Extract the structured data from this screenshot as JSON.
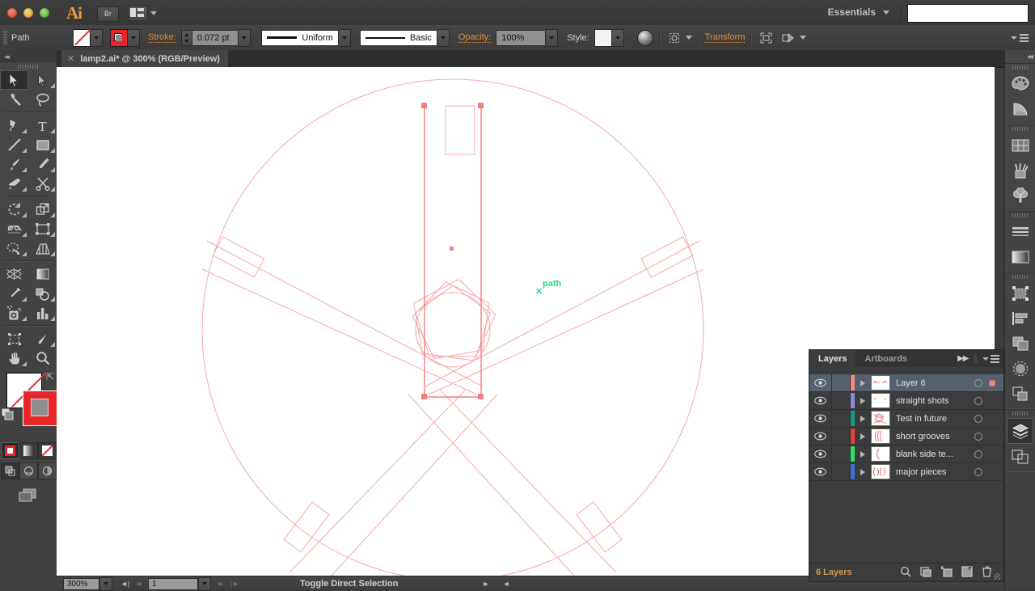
{
  "app": {
    "name": "Adobe Illustrator",
    "logo_text": "Ai",
    "bridge_label": "Br",
    "workspace": "Essentials",
    "search_value": ""
  },
  "control_bar": {
    "object_label": "Path",
    "fill_icon": "fill-none-swatch",
    "stroke_icon": "stroke-red-swatch",
    "stroke_label": "Stroke:",
    "stroke_weight": "0.072 pt",
    "stroke_profile": "Uniform",
    "brush_definition": "Basic",
    "opacity_label": "Opacity:",
    "opacity_value": "100%",
    "style_label": "Style:",
    "transform_label": "Transform",
    "recolor_icon": "recolor-artwork-icon",
    "align_icon": "align-options-icon",
    "isolate_icon": "isolate-selected-icon",
    "mask_icon": "edit-clipping-path-icon",
    "panel_menu_icon": "panel-menu-icon"
  },
  "document_tab": {
    "close_icon": "close-icon",
    "title": "lamp2.ai* @ 300% (RGB/Preview)"
  },
  "toolbar": {
    "tools": [
      {
        "name": "selection-tool",
        "selected": true
      },
      {
        "name": "direct-selection-tool",
        "selected": false
      },
      {
        "name": "magic-wand-tool",
        "selected": false
      },
      {
        "name": "lasso-tool",
        "selected": false
      },
      {
        "name": "pen-tool",
        "selected": false
      },
      {
        "name": "type-tool",
        "selected": false
      },
      {
        "name": "line-segment-tool",
        "selected": false
      },
      {
        "name": "rectangle-tool",
        "selected": false
      },
      {
        "name": "paintbrush-tool",
        "selected": false
      },
      {
        "name": "pencil-tool",
        "selected": false
      },
      {
        "name": "blob-brush-tool",
        "selected": false
      },
      {
        "name": "eraser-scissors-tool",
        "selected": false
      },
      {
        "name": "rotate-tool",
        "selected": false
      },
      {
        "name": "scale-tool",
        "selected": false
      },
      {
        "name": "width-tool",
        "selected": false
      },
      {
        "name": "free-transform-tool",
        "selected": false
      },
      {
        "name": "shape-builder-tool",
        "selected": false
      },
      {
        "name": "perspective-grid-tool",
        "selected": false
      },
      {
        "name": "mesh-tool",
        "selected": false
      },
      {
        "name": "gradient-tool",
        "selected": false
      },
      {
        "name": "eyedropper-tool",
        "selected": false
      },
      {
        "name": "blend-tool",
        "selected": false
      },
      {
        "name": "symbol-sprayer-tool",
        "selected": false
      },
      {
        "name": "column-graph-tool",
        "selected": false
      },
      {
        "name": "artboard-tool",
        "selected": false
      },
      {
        "name": "slice-tool",
        "selected": false
      },
      {
        "name": "hand-tool",
        "selected": false
      },
      {
        "name": "zoom-tool",
        "selected": false
      }
    ],
    "fill_state": "none",
    "stroke_color": "#e8262a",
    "paint_modes": [
      "color-mode",
      "gradient-mode",
      "none-mode"
    ],
    "screen_mode_icon": "change-screen-mode-icon"
  },
  "canvas": {
    "smart_guide_label": "path",
    "artwork_stroke_color": "#f4a0a0",
    "selection_color": "#f08080",
    "description": "lamp outline drawing: circle, five radiating arms, center pentagon and star"
  },
  "right_dock": {
    "collapse_icon": "collapse-panels-icon",
    "groups": [
      {
        "icons": [
          "color-panel-icon",
          "color-guide-panel-icon"
        ]
      },
      {
        "icons": [
          "swatches-panel-icon",
          "brushes-panel-icon",
          "symbols-panel-icon"
        ]
      },
      {
        "icons": [
          "stroke-panel-icon",
          "gradient-panel-icon"
        ]
      },
      {
        "icons": [
          "transform-panel-icon",
          "align-panel-icon",
          "pathfinder-panel-icon",
          "transparency-panel-icon",
          "appearance-panel-icon"
        ]
      },
      {
        "icons": [
          "layers-panel-icon",
          "artboards-panel-icon"
        ]
      }
    ]
  },
  "layers_panel": {
    "tabs": [
      {
        "label": "Layers",
        "active": true
      },
      {
        "label": "Artboards",
        "active": false
      }
    ],
    "expand_icon": "double-chevron-right-icon",
    "menu_icon": "panel-menu-icon",
    "rows": [
      {
        "name": "Layer 6",
        "color": "#f08a84",
        "visible": true,
        "selected": true,
        "has_target_circle": true,
        "has_selection_square": true
      },
      {
        "name": "straight shots",
        "color": "#8f86e0",
        "visible": true,
        "selected": false,
        "has_target_circle": true,
        "has_selection_square": false
      },
      {
        "name": "Test in future",
        "color": "#0e9b86",
        "visible": true,
        "selected": false,
        "has_target_circle": true,
        "has_selection_square": false
      },
      {
        "name": "short grooves",
        "color": "#ef3b3b",
        "visible": true,
        "selected": false,
        "has_target_circle": true,
        "has_selection_square": false
      },
      {
        "name": "blank side te...",
        "color": "#2ce05a",
        "visible": true,
        "selected": false,
        "has_target_circle": true,
        "has_selection_square": false
      },
      {
        "name": "major pieces",
        "color": "#3c6fe0",
        "visible": true,
        "selected": false,
        "has_target_circle": true,
        "has_selection_square": false
      }
    ],
    "footer": {
      "count_label": "6 Layers",
      "icons": [
        "locate-object-icon",
        "make-clipping-mask-icon",
        "create-new-sublayer-icon",
        "create-new-layer-icon",
        "delete-selection-icon"
      ]
    }
  },
  "status_bar": {
    "zoom_level": "300%",
    "artboard_number": "1",
    "status_text": "Toggle Direct Selection",
    "first_icon": "first-artboard-icon",
    "prev_icon": "previous-artboard-icon",
    "next_icon": "next-artboard-icon",
    "last_icon": "last-artboard-icon"
  }
}
